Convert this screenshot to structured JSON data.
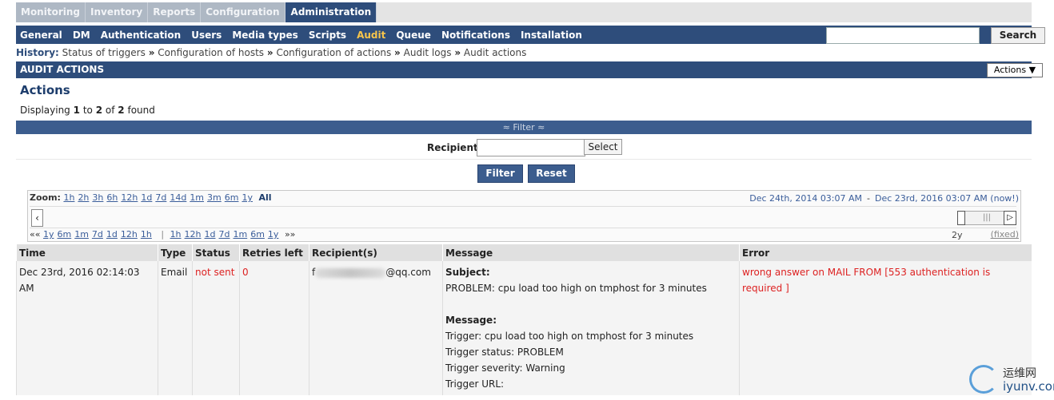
{
  "top_tabs": [
    {
      "label": "Monitoring"
    },
    {
      "label": "Inventory"
    },
    {
      "label": "Reports"
    },
    {
      "label": "Configuration"
    },
    {
      "label": "Administration"
    }
  ],
  "sub_tabs": [
    {
      "label": "General"
    },
    {
      "label": "DM"
    },
    {
      "label": "Authentication"
    },
    {
      "label": "Users"
    },
    {
      "label": "Media types"
    },
    {
      "label": "Scripts"
    },
    {
      "label": "Audit"
    },
    {
      "label": "Queue"
    },
    {
      "label": "Notifications"
    },
    {
      "label": "Installation"
    }
  ],
  "search": {
    "value": "",
    "button": "Search"
  },
  "history": {
    "label": "History:",
    "items": [
      "Status of triggers",
      "Configuration of hosts",
      "Configuration of actions",
      "Audit logs",
      "Audit actions"
    ],
    "separator": "»"
  },
  "section": {
    "title": "AUDIT ACTIONS",
    "actions_select": "Actions ▼"
  },
  "page": {
    "title": "Actions",
    "displaying_prefix": "Displaying",
    "from": "1",
    "to_word": "to",
    "to": "2",
    "of_word": "of",
    "total": "2",
    "found_word": "found"
  },
  "filter": {
    "bar_label": "≈ Filter ≈",
    "recipient_label": "Recipient",
    "recipient_value": "",
    "select_button": "Select",
    "filter_button": "Filter",
    "reset_button": "Reset"
  },
  "timeline": {
    "zoom_label": "Zoom:",
    "zoom_options": [
      "1h",
      "2h",
      "3h",
      "6h",
      "12h",
      "1d",
      "7d",
      "14d",
      "1m",
      "3m",
      "6m",
      "1y"
    ],
    "zoom_all": "All",
    "range_from": "Dec 24th, 2014 03:07 AM",
    "range_dash": "-",
    "range_to": "Dec 23rd, 2016 03:07 AM (now!)",
    "back_prefix": "««",
    "back_options": [
      "1y",
      "6m",
      "1m",
      "7d",
      "1d",
      "12h",
      "1h"
    ],
    "forward_options": [
      "1h",
      "12h",
      "1d",
      "7d",
      "1m",
      "6m",
      "1y"
    ],
    "forward_suffix": "»»",
    "divider": "|",
    "period": "2y",
    "fixed": "(fixed)"
  },
  "table": {
    "headers": [
      "Time",
      "Type",
      "Status",
      "Retries left",
      "Recipient(s)",
      "Message",
      "Error"
    ],
    "rows": [
      {
        "time": "Dec 23rd, 2016 02:14:03 AM",
        "type": "Email",
        "status": "not sent",
        "retries_left": "0",
        "recipient_prefix": "f",
        "recipient_suffix": "@qq.com",
        "subject_label": "Subject:",
        "subject_text": "PROBLEM: cpu load too high on tmphost for 3 minutes",
        "message_label": "Message:",
        "message_lines": [
          "Trigger: cpu load too high on tmphost for 3 minutes",
          "Trigger status: PROBLEM",
          "Trigger severity: Warning",
          "Trigger URL:"
        ],
        "error": "wrong answer on MAIL FROM [553 authentication is required ]"
      }
    ]
  },
  "watermark": {
    "cn": "运维网",
    "en": "iyunv.com"
  }
}
